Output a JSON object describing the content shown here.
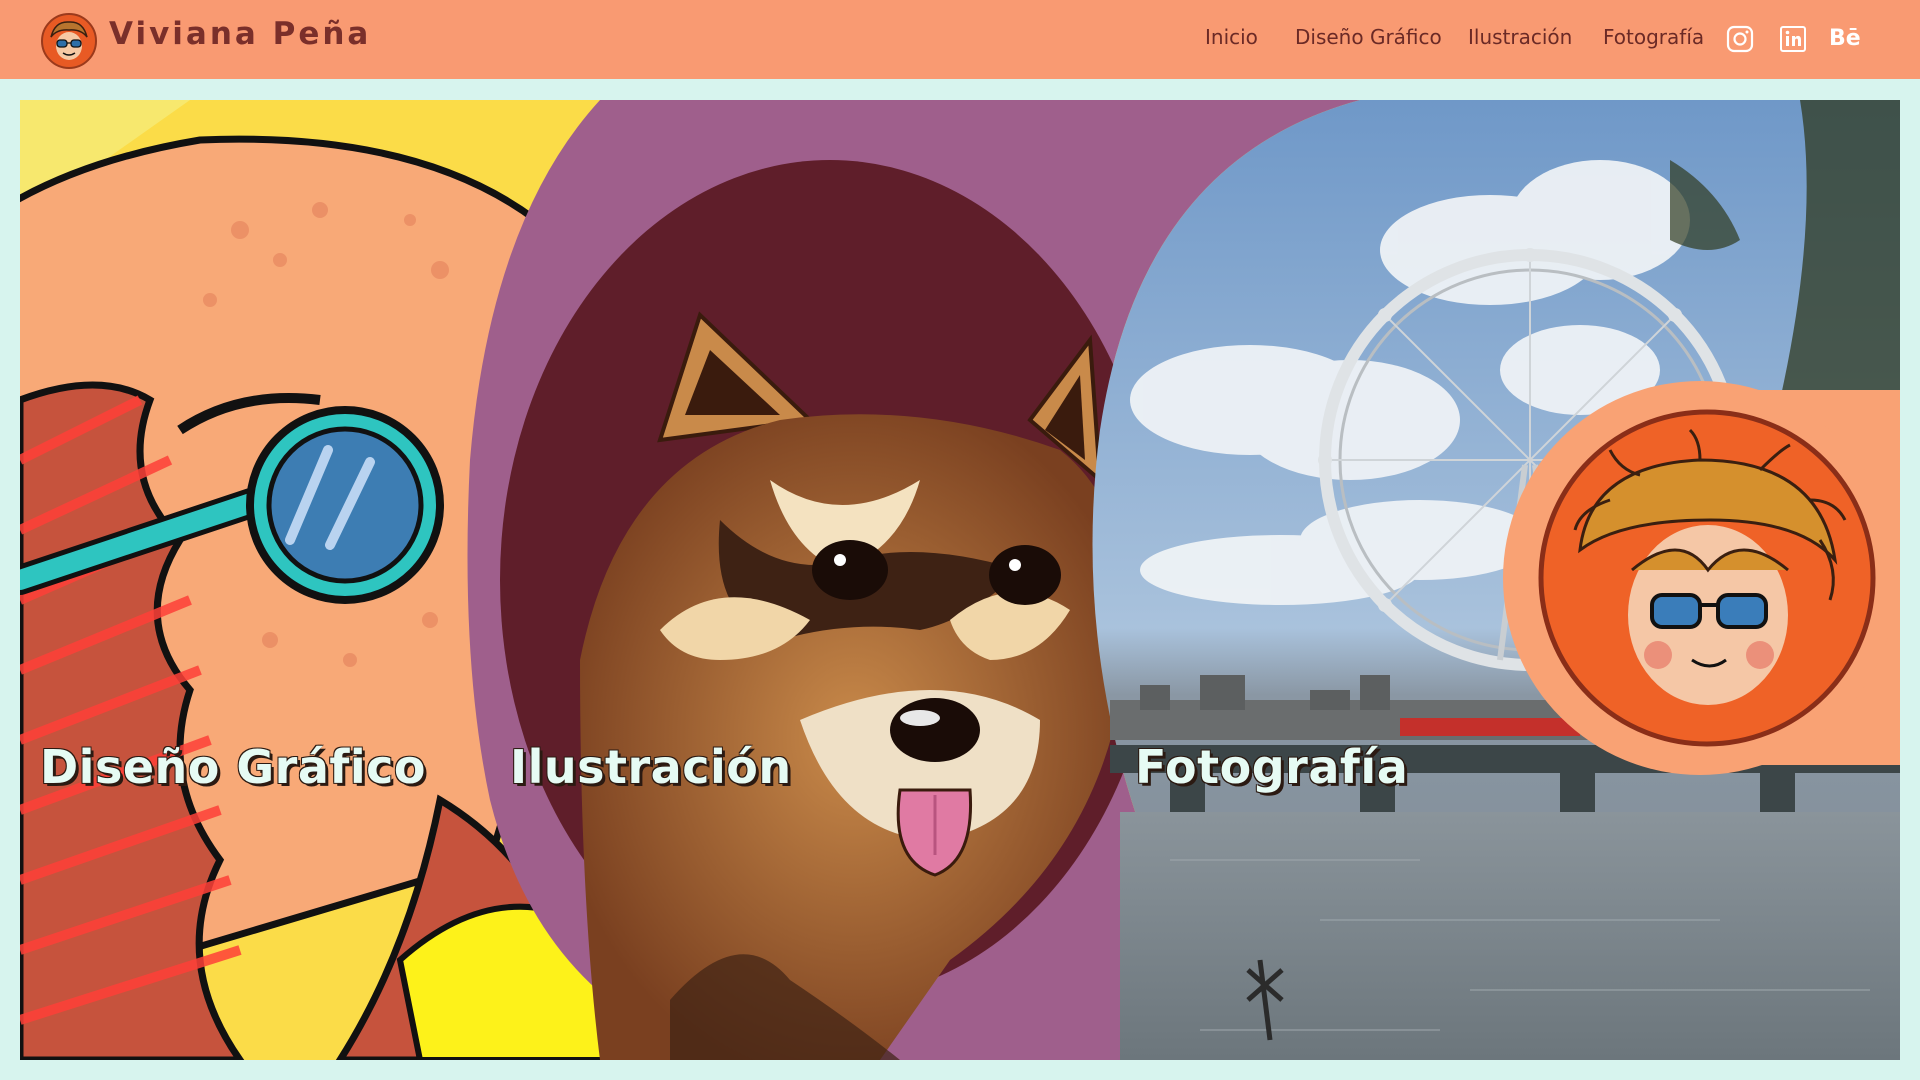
{
  "header": {
    "site_title": "Viviana Peña",
    "logo_icon": "avatar-logo-icon",
    "nav": {
      "inicio": "Inicio",
      "diseno": "Diseño Gráfico",
      "ilustracion": "Ilustración",
      "fotografia": "Fotografía"
    },
    "social": {
      "instagram_icon": "instagram-icon",
      "linkedin_icon": "linkedin-icon",
      "behance_label": "Bē"
    }
  },
  "hero": {
    "panels": [
      {
        "label": "Diseño Gráfico"
      },
      {
        "label": "Ilustración"
      },
      {
        "label": "Fotografía"
      }
    ]
  },
  "colors": {
    "header_bg": "#f99a72",
    "page_bg": "#d7f4ee",
    "title_text": "#7a2f2a",
    "nav_text": "#6b2a26",
    "label_text": "#e6fbf4"
  }
}
